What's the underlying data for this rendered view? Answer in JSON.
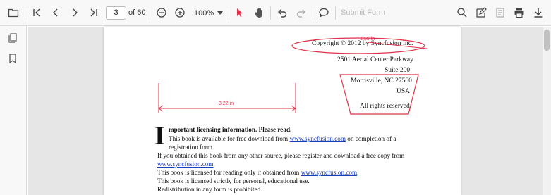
{
  "toolbar": {
    "current_page": "3",
    "page_count_label": "of 60",
    "zoom": "100%",
    "submit_form_label": "Submit Form"
  },
  "document": {
    "address": {
      "copyright": "Copyright © 2012 by Syncfusion Inc.",
      "street": "2501 Aerial Center Parkway",
      "suite": "Suite 200",
      "city": "Morrisville, NC 27560",
      "country": "USA",
      "rights": "All rights reserved."
    },
    "notice": {
      "dropcap": "I",
      "heading": "mportant licensing information. Please read.",
      "l1_pre": "This book is available for free download from ",
      "l1_link": "www.syncfusion.com",
      "l1_post": " on completion of a",
      "l2": "registration form.",
      "l3": "If you obtained this book from any other source, please register and download a free copy from",
      "l4_link": "www.syncfusion.com",
      "l4_post": ".",
      "l5_pre": "This book is licensed for reading only if obtained from ",
      "l5_link": "www.syncfusion.com",
      "l5_post": ".",
      "l6": "This book is licensed strictly for personal, educational use.",
      "l7": "Redistribution in any form is prohibited."
    },
    "annotations": {
      "ellipse_label": "1.55 in",
      "distance_label": "3.22 in",
      "color": "#e0324a"
    }
  }
}
